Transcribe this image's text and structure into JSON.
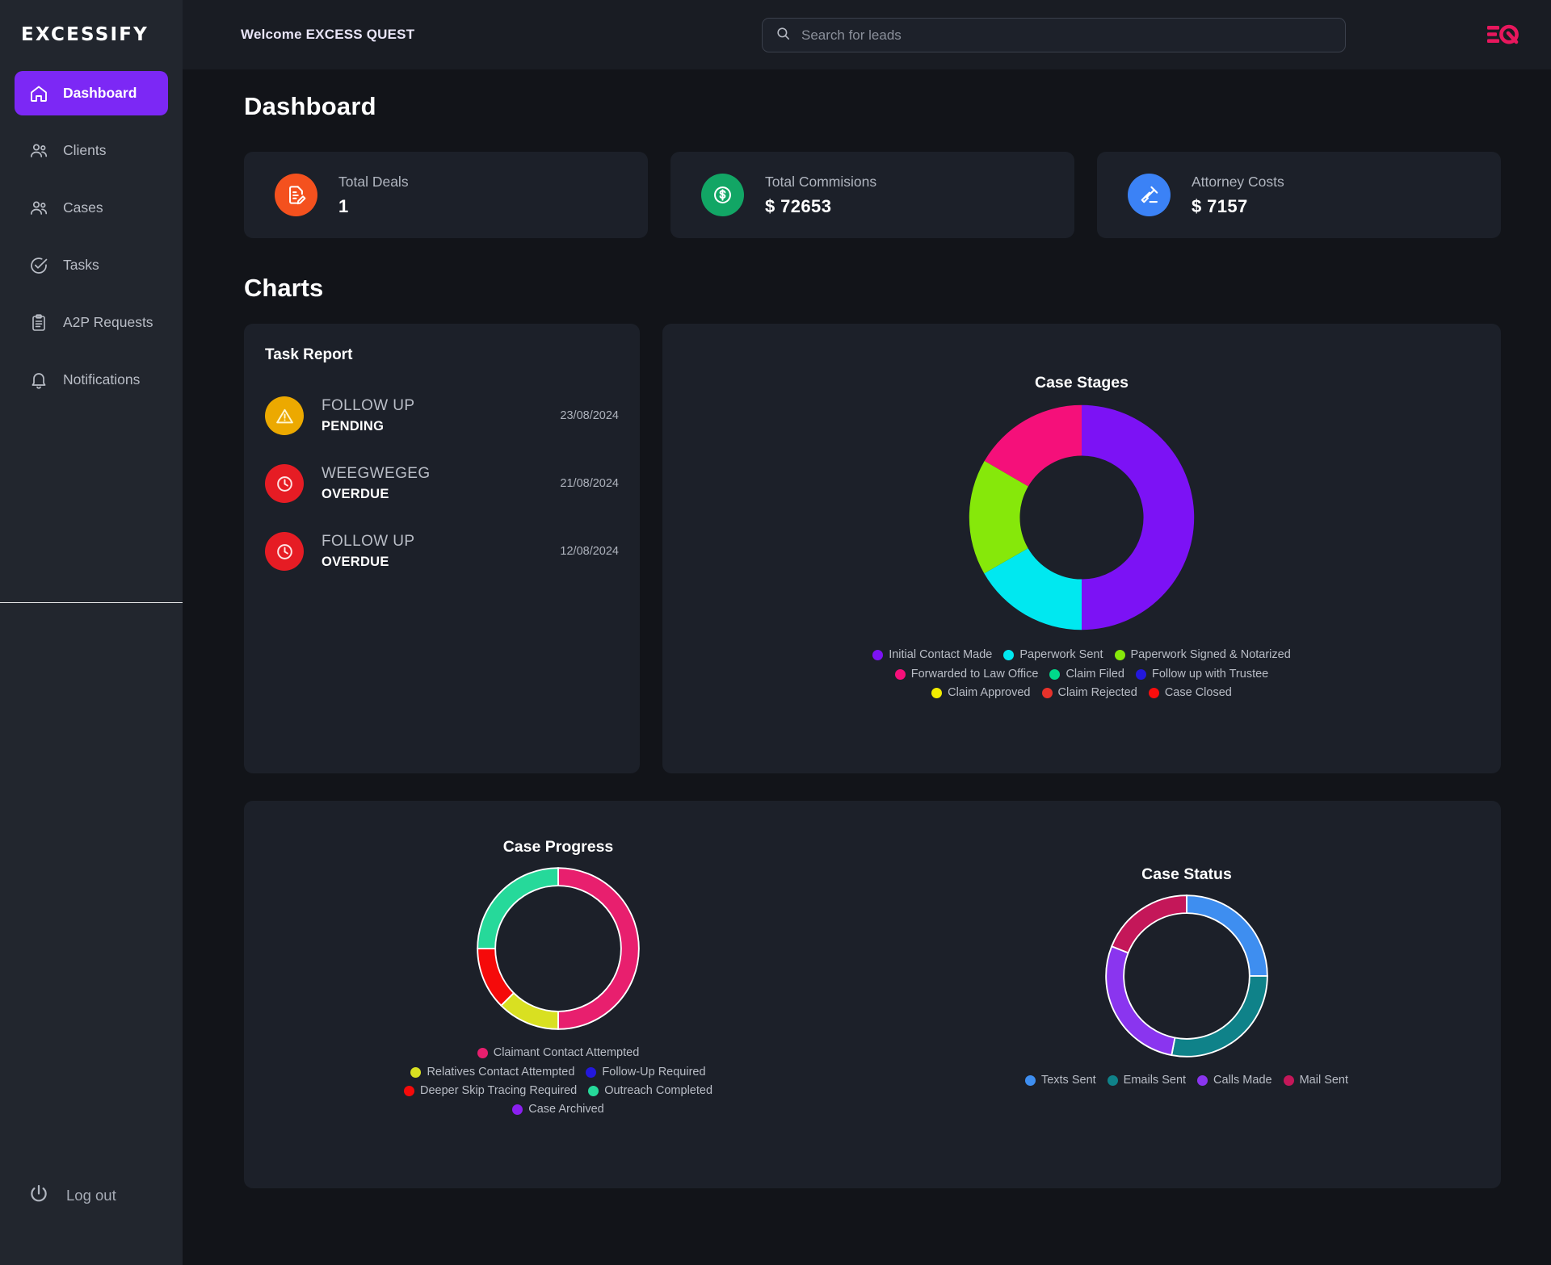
{
  "brand": {
    "name": "EXCESSIFY",
    "logo_mark": "eq-logo"
  },
  "sidebar": {
    "items": [
      {
        "label": "Dashboard",
        "icon": "home-icon",
        "active": true
      },
      {
        "label": "Clients",
        "icon": "users-icon",
        "active": false
      },
      {
        "label": "Cases",
        "icon": "users-icon",
        "active": false
      },
      {
        "label": "Tasks",
        "icon": "check-circle-icon",
        "active": false
      },
      {
        "label": "A2P Requests",
        "icon": "clipboard-icon",
        "active": false
      },
      {
        "label": "Notifications",
        "icon": "bell-icon",
        "active": false
      }
    ],
    "logout": {
      "label": "Log out",
      "icon": "power-icon"
    }
  },
  "topbar": {
    "welcome": "Welcome EXCESS QUEST",
    "search": {
      "placeholder": "Search for leads",
      "value": "",
      "icon": "search-icon"
    }
  },
  "page": {
    "title": "Dashboard",
    "charts_section_title": "Charts"
  },
  "stats": [
    {
      "label": "Total Deals",
      "value": "1",
      "icon": "document-edit-icon",
      "color": "#f4511e"
    },
    {
      "label": "Total Commisions",
      "value": "$ 72653",
      "icon": "dollar-circle-icon",
      "color": "#12a665"
    },
    {
      "label": "Attorney Costs",
      "value": "$ 7157",
      "icon": "gavel-icon",
      "color": "#3b82f6"
    }
  ],
  "task_report": {
    "title": "Task Report",
    "rows": [
      {
        "name": "FOLLOW UP",
        "status": "PENDING",
        "date": "23/08/2024",
        "badge_icon": "warning-icon",
        "badge_color": "#eca900"
      },
      {
        "name": "WEEGWEGEG",
        "status": "OVERDUE",
        "date": "21/08/2024",
        "badge_icon": "clock-icon",
        "badge_color": "#e61c24"
      },
      {
        "name": "FOLLOW UP",
        "status": "OVERDUE",
        "date": "12/08/2024",
        "badge_icon": "clock-icon",
        "badge_color": "#e61c24"
      }
    ]
  },
  "chart_data": [
    {
      "type": "pie",
      "name": "case-stages",
      "title": "Case Stages",
      "legend_position": "bottom",
      "categories": [
        "Initial Contact Made",
        "Paperwork Sent",
        "Paperwork Signed & Notarized",
        "Forwarded to Law Office",
        "Claim Filed",
        "Follow up with Trustee",
        "Claim Approved",
        "Claim Rejected",
        "Case Closed"
      ],
      "values": [
        50,
        16.7,
        16.7,
        16.6,
        0,
        0,
        0,
        0,
        0
      ],
      "colors": [
        "#7c12f5",
        "#00e8f0",
        "#86e80a",
        "#f5107a",
        "#00d98a",
        "#2318dc",
        "#f2ec00",
        "#e8322b",
        "#fa0d0d"
      ],
      "donut_hole": 0.55
    },
    {
      "type": "pie",
      "name": "case-progress",
      "title": "Case Progress",
      "legend_position": "bottom",
      "categories": [
        "Claimant Contact Attempted",
        "Relatives Contact Attempted",
        "Follow-Up Required",
        "Deeper Skip Tracing Required",
        "Outreach Completed",
        "Case Archived"
      ],
      "values": [
        50,
        12.5,
        0,
        12.5,
        25,
        0
      ],
      "colors": [
        "#e81f6e",
        "#d9e021",
        "#2318dc",
        "#f50a0a",
        "#26d99a",
        "#8a1ff0"
      ],
      "donut_hole": 0.78
    },
    {
      "type": "pie",
      "name": "case-status",
      "title": "Case Status",
      "legend_position": "bottom",
      "categories": [
        "Texts Sent",
        "Emails Sent",
        "Calls Made",
        "Mail Sent"
      ],
      "values": [
        25,
        28,
        28,
        19
      ],
      "colors": [
        "#3e8ef0",
        "#0f8289",
        "#8a35ef",
        "#c41759"
      ],
      "donut_hole": 0.78
    }
  ],
  "theme": {
    "accent": "#7c28f5",
    "brand_pink": "#e8175d",
    "sidebar_bg": "#22262e",
    "card_bg": "#1c2029",
    "page_bg": "#121419"
  }
}
